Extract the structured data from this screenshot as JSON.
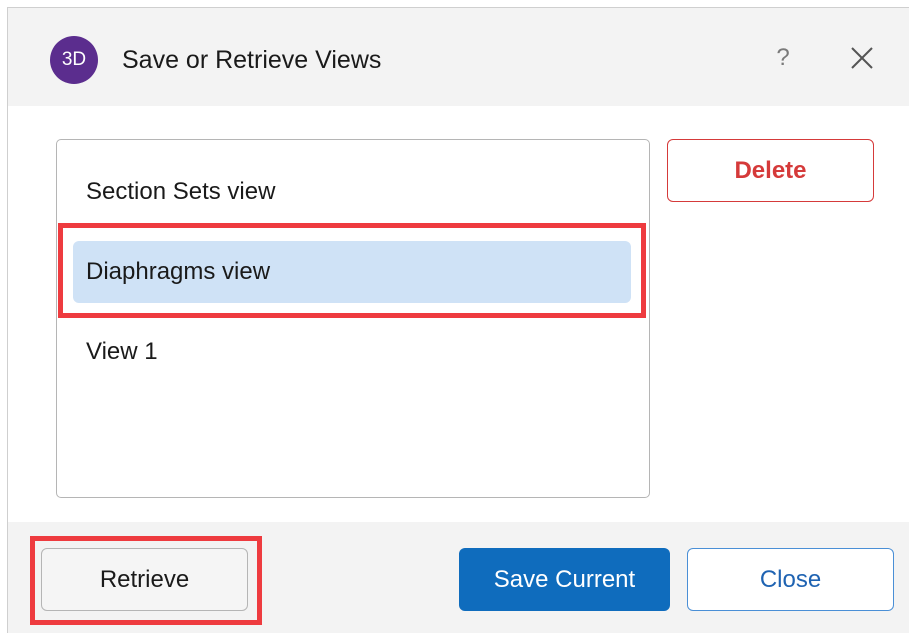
{
  "dialog": {
    "title": "Save or Retrieve Views",
    "app_icon_label": "3D",
    "help_label": "?",
    "icons": {
      "app": "3d-app-icon",
      "help": "help-icon",
      "close": "close-icon"
    }
  },
  "views": {
    "items": [
      {
        "label": "Section Sets view",
        "selected": false
      },
      {
        "label": "Diaphragms view",
        "selected": true
      },
      {
        "label": "View 1",
        "selected": false
      }
    ]
  },
  "buttons": {
    "delete": "Delete",
    "retrieve": "Retrieve",
    "save_current": "Save Current",
    "close": "Close"
  },
  "colors": {
    "accent": "#0f6cbd",
    "selection": "#cfe2f6",
    "danger": "#d53a3a",
    "highlight": "#ee3b3f",
    "app_icon": "#5b2d8e"
  }
}
